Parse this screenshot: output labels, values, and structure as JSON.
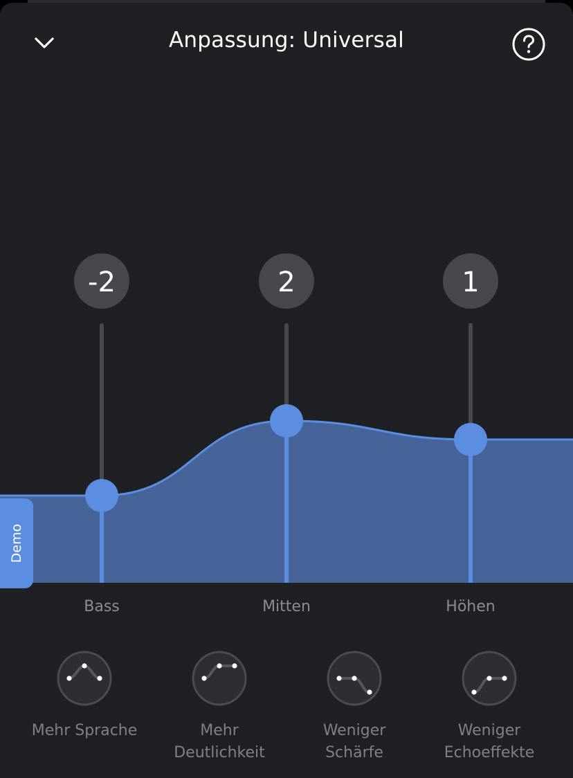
{
  "header": {
    "title": "Anpassung: Universal"
  },
  "demo": {
    "label": "Demo"
  },
  "equalizer": {
    "bands": [
      {
        "name": "Bass",
        "value": "-2",
        "level": -2
      },
      {
        "name": "Mitten",
        "value": "2",
        "level": 2
      },
      {
        "name": "Höhen",
        "value": "1",
        "level": 1
      }
    ],
    "level_range": [
      -6,
      6
    ]
  },
  "presets": [
    {
      "label_line1": "Mehr Sprache",
      "label_line2": ""
    },
    {
      "label_line1": "Mehr",
      "label_line2": "Deutlichkeit"
    },
    {
      "label_line1": "Weniger",
      "label_line2": "Schärfe"
    },
    {
      "label_line1": "Weniger",
      "label_line2": "Echoeffekte"
    }
  ],
  "colors": {
    "background": "#1f2024",
    "accent": "#5b8ee0",
    "fill": "#46649a",
    "track": "#47494e",
    "bubble": "#46484d",
    "label": "#8b8d93"
  }
}
